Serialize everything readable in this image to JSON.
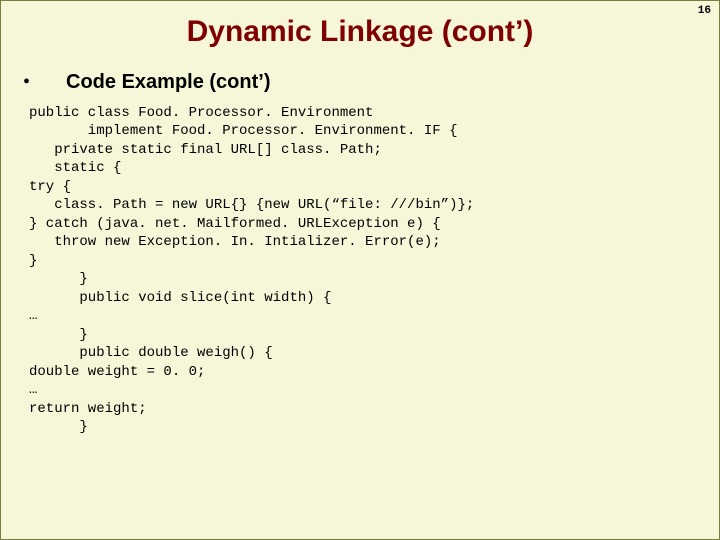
{
  "pageNumber": "16",
  "title": "Dynamic Linkage (cont’)",
  "subhead": "Code Example (cont’)",
  "code": "public class Food. Processor. Environment\n       implement Food. Processor. Environment. IF {\n   private static final URL[] class. Path;\n   static {\ntry {\n   class. Path = new URL{} {new URL(“file: ///bin”)};\n} catch (java. net. Mailformed. URLException e) {\n   throw new Exception. In. Intializer. Error(e);\n}\n      }\n      public void slice(int width) {\n…\n      }\n      public double weigh() {\ndouble weight = 0. 0;\n…\nreturn weight;\n      }"
}
